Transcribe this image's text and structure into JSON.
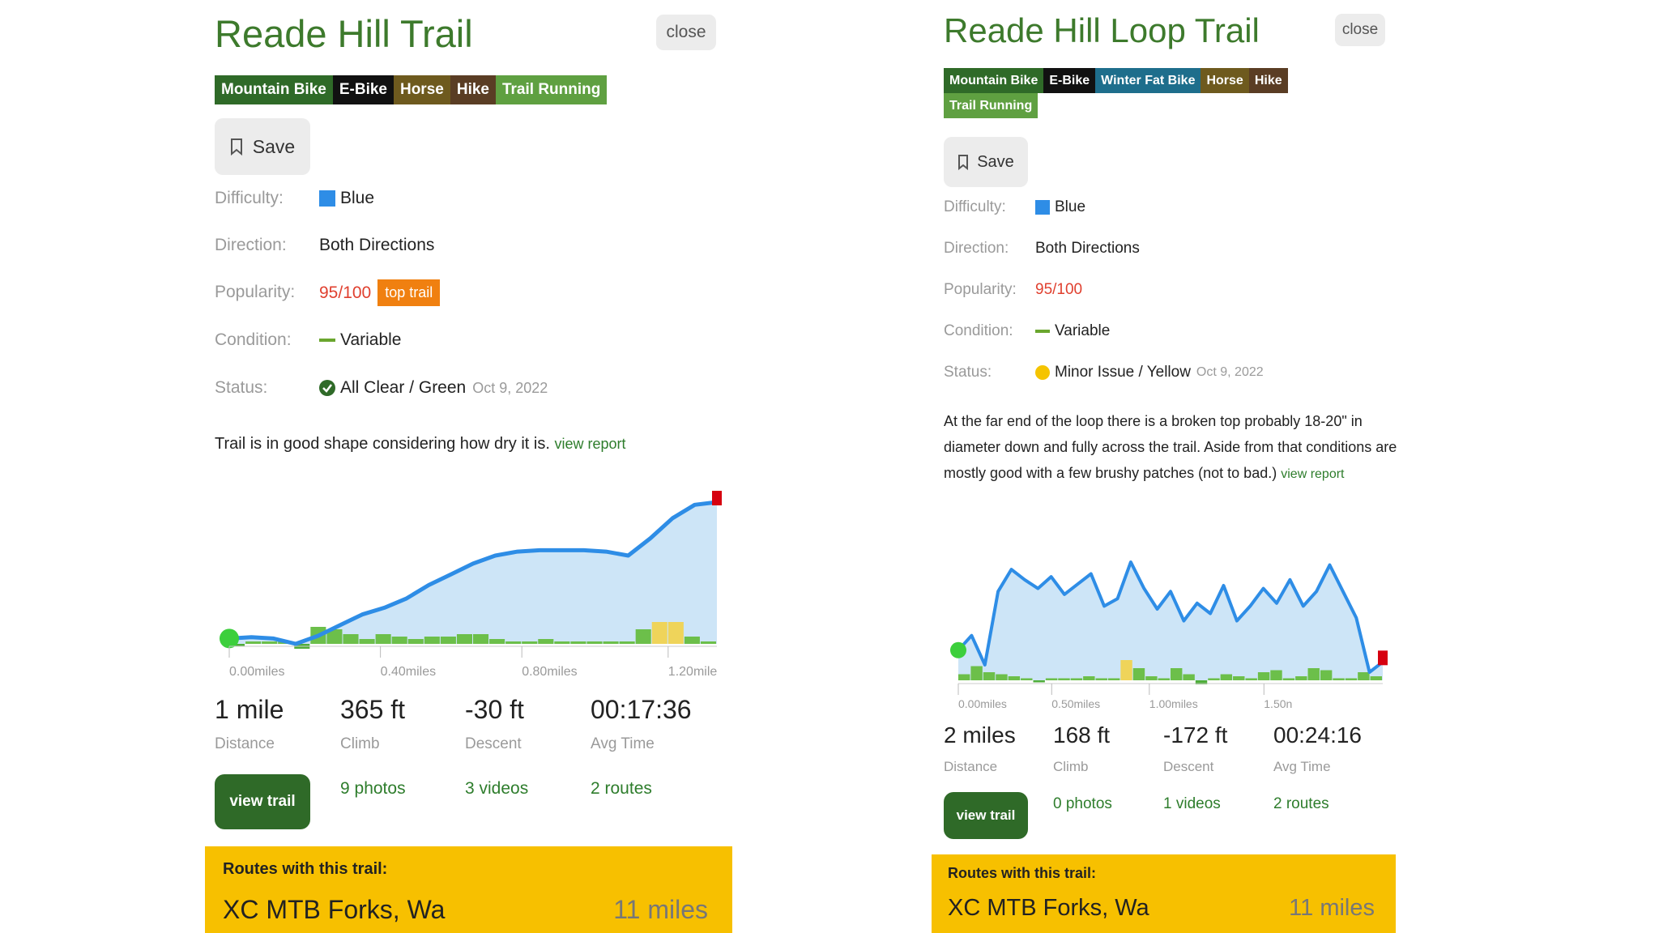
{
  "panels": [
    {
      "title": "Reade Hill Trail",
      "close_label": "close",
      "tags": [
        {
          "label": "Mountain Bike",
          "color": "#2f6a28"
        },
        {
          "label": "E-Bike",
          "color": "#111111"
        },
        {
          "label": "Horse",
          "color": "#6e5a1e"
        },
        {
          "label": "Hike",
          "color": "#5a3d24"
        },
        {
          "label": "Trail Running",
          "color": "#5fa041"
        }
      ],
      "save_label": "Save",
      "difficulty": {
        "label": "Difficulty:",
        "value": "Blue",
        "color": "#2e8de6"
      },
      "direction": {
        "label": "Direction:",
        "value": "Both Directions"
      },
      "popularity": {
        "label": "Popularity:",
        "value": "95/100",
        "badge": "top trail"
      },
      "condition": {
        "label": "Condition:",
        "value": "Variable"
      },
      "status": {
        "label": "Status:",
        "value": "All Clear / Green",
        "date": "Oct 9, 2022",
        "icon": "check-circle-icon",
        "color": "#2f6a28"
      },
      "report": {
        "text": "Trail is in good shape considering how dry it is.",
        "link": "view report"
      },
      "profile": {
        "x_ticks": [
          "0.00miles",
          "0.40miles",
          "0.80miles",
          "1.20mile"
        ],
        "elevation": [
          10,
          11,
          10,
          6,
          12,
          20,
          28,
          33,
          40,
          50,
          58,
          66,
          72,
          75,
          76,
          76,
          76,
          75,
          72,
          85,
          100,
          110,
          112
        ],
        "grade_bars": [
          -1,
          1,
          1,
          1,
          -2,
          7,
          6,
          4,
          2,
          4,
          3,
          2,
          3,
          3,
          4,
          4,
          2,
          1,
          1,
          2,
          1,
          1,
          1,
          1,
          1,
          6,
          9,
          9,
          3,
          1
        ]
      },
      "stats": [
        {
          "value": "1 mile",
          "label": "Distance"
        },
        {
          "value": "365 ft",
          "label": "Climb"
        },
        {
          "value": "-30 ft",
          "label": "Descent"
        },
        {
          "value": "00:17:36",
          "label": "Avg Time"
        }
      ],
      "view_trail_label": "view trail",
      "links": [
        "9 photos",
        "3 videos",
        "2 routes"
      ],
      "routes": {
        "heading": "Routes with this trail:",
        "name": "XC MTB Forks, Wa",
        "miles": "11 miles"
      }
    },
    {
      "title": "Reade Hill Loop Trail",
      "close_label": "close",
      "tags": [
        {
          "label": "Mountain Bike",
          "color": "#2f6a28"
        },
        {
          "label": "E-Bike",
          "color": "#111111"
        },
        {
          "label": "Winter Fat Bike",
          "color": "#1e6e8c"
        },
        {
          "label": "Horse",
          "color": "#6e5a1e"
        },
        {
          "label": "Hike",
          "color": "#5a3d24"
        },
        {
          "label": "Trail Running",
          "color": "#5fa041"
        }
      ],
      "save_label": "Save",
      "difficulty": {
        "label": "Difficulty:",
        "value": "Blue",
        "color": "#2e8de6"
      },
      "direction": {
        "label": "Direction:",
        "value": "Both Directions"
      },
      "popularity": {
        "label": "Popularity:",
        "value": "95/100",
        "badge": ""
      },
      "condition": {
        "label": "Condition:",
        "value": "Variable"
      },
      "status": {
        "label": "Status:",
        "value": "Minor Issue / Yellow",
        "date": "Oct 9, 2022",
        "icon": "yellow-dot-icon",
        "color": "#f5c400"
      },
      "report": {
        "text": "At the far end of the loop there is a broken top probably 18-20\" in diameter down and fully across the trail. Aside from that conditions are mostly good with a few brushy patches (not to bad.)",
        "link": "view report"
      },
      "profile": {
        "x_ticks": [
          "0.00miles",
          "0.50miles",
          "1.00miles",
          "1.50n"
        ],
        "elevation": [
          30,
          40,
          20,
          70,
          85,
          78,
          72,
          80,
          68,
          75,
          82,
          60,
          65,
          90,
          72,
          58,
          70,
          50,
          62,
          55,
          74,
          50,
          60,
          72,
          62,
          78,
          60,
          70,
          88,
          70,
          52,
          15,
          22
        ],
        "grade_bars": [
          3,
          7,
          4,
          3,
          2,
          1,
          -1,
          1,
          1,
          1,
          2,
          1,
          1,
          10,
          6,
          2,
          1,
          6,
          3,
          -2,
          1,
          3,
          2,
          1,
          4,
          5,
          1,
          2,
          6,
          5,
          1,
          1,
          4,
          2
        ]
      },
      "stats": [
        {
          "value": "2 miles",
          "label": "Distance"
        },
        {
          "value": "168 ft",
          "label": "Climb"
        },
        {
          "value": "-172 ft",
          "label": "Descent"
        },
        {
          "value": "00:24:16",
          "label": "Avg Time"
        }
      ],
      "view_trail_label": "view trail",
      "links": [
        "0 photos",
        "1 videos",
        "2 routes"
      ],
      "routes": {
        "heading": "Routes with this trail:",
        "name": "XC MTB Forks, Wa",
        "miles": "11 miles"
      }
    }
  ]
}
